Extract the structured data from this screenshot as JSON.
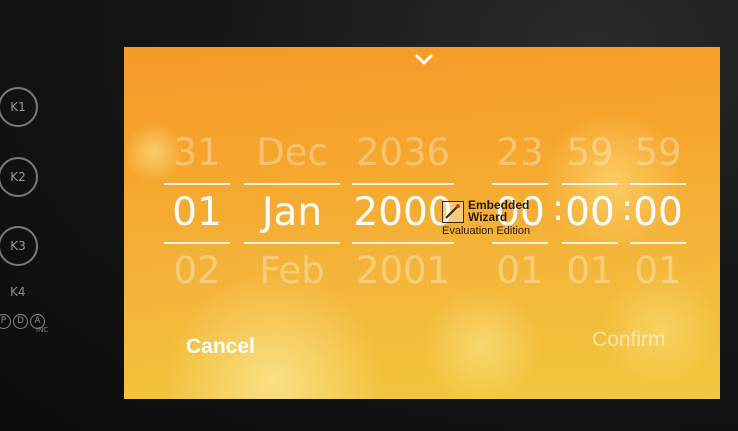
{
  "hardware_buttons": [
    {
      "label": "K1"
    },
    {
      "label": "K2"
    },
    {
      "label": "K3"
    }
  ],
  "hardware_k4_label": "K4",
  "brand_logo": {
    "letters": [
      "P",
      "D",
      "A"
    ],
    "suffix": "INC"
  },
  "picker": {
    "day": {
      "prev": "31",
      "current": "01",
      "next": "02"
    },
    "month": {
      "prev": "Dec",
      "current": "Jan",
      "next": "Feb"
    },
    "year": {
      "prev": "2036",
      "current": "2000",
      "next": "2001"
    },
    "hour": {
      "prev": "23",
      "current": "00",
      "next": "01"
    },
    "minute": {
      "prev": "59",
      "current": "00",
      "next": "01"
    },
    "second": {
      "prev": "59",
      "current": "00",
      "next": "01"
    },
    "time_separator": ":"
  },
  "actions": {
    "cancel": "Cancel",
    "confirm": "Confirm"
  },
  "watermark": {
    "line1": "Embedded",
    "line2": "Wizard",
    "line3": "Evaluation Edition"
  },
  "icons": {
    "top": "chevron-down-icon"
  },
  "colors": {
    "accent_top": "#f59a2a",
    "accent_bottom": "#f2c83c"
  }
}
